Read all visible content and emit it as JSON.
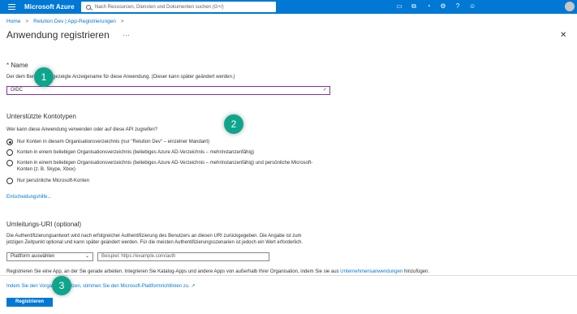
{
  "topbar": {
    "brand": "Microsoft Azure",
    "search_placeholder": "Nach Ressourcen, Diensten und Dokumenten suchen (G+/)"
  },
  "breadcrumb": {
    "home": "Home",
    "sep": ">",
    "parent": "Relution Dev | App-Registrierungen"
  },
  "page": {
    "title": "Anwendung registrieren",
    "more": "···",
    "close": "✕"
  },
  "name_section": {
    "required_mark": "*",
    "label": "Name",
    "description": "Der dem Benutzer angezeigte Anzeigename für diese Anwendung. (Dieser kann später geändert werden.)",
    "value": "OIDC"
  },
  "account_section": {
    "title": "Unterstützte Kontotypen",
    "question": "Wer kann diese Anwendung verwenden oder auf diese API zugreifen?",
    "options": [
      "Nur Konten in diesem Organisationsverzeichnis (nur \"Relution Dev\" – einzelner Mandant)",
      "Konten in einem beliebigen Organisationsverzeichnis (beliebiges Azure AD-Verzeichnis – mehrinstanzenfähig)",
      "Konten in einem beliebigen Organisationsverzeichnis (beliebiges Azure AD-Verzeichnis – mehrinstanzenfähig) und persönliche Microsoft-Konten (z. B. Skype, Xbox)",
      "Nur persönliche Microsoft-Konten"
    ],
    "help_link": "Entscheidungshilfe..."
  },
  "redirect_section": {
    "title": "Umleitungs-URI (optional)",
    "description_1": "Die Authentifizierungsantwort wird nach erfolgreicher Authentifizierung des Benutzers an diesen URI zurückgegeben. Die Angabe ist zum",
    "description_2": "jetzigen Zeitpunkt optional und kann später geändert werden. Für die meisten Authentifizierungsszenarien ist jedoch ein Wert erforderlich.",
    "platform_placeholder": "Plattform auswählen",
    "uri_placeholder": "Beispiel: https://example.com/auth",
    "register_note": "Registrieren Sie eine App, an der Sie gerade arbeiten. Integrieren Sie Katalog-Apps und andere Apps von außerhalb Ihrer Organisation, indem Sie sie aus",
    "register_link": "Unternehmensanwendungen",
    "register_note_end": "hinzufügen."
  },
  "footer": {
    "policy_text": "Indem Sie den Vorgang fortsetzen, stimmen Sie den Microsoft-Plattformrichtlinien zu.",
    "external_icon": "↗",
    "register_button": "Registrieren"
  },
  "badges": [
    "1",
    "2",
    "3"
  ],
  "colors": {
    "azure_blue": "#0078d4",
    "badge_teal": "#0fa58d",
    "input_border_active": "#8a2da5"
  }
}
